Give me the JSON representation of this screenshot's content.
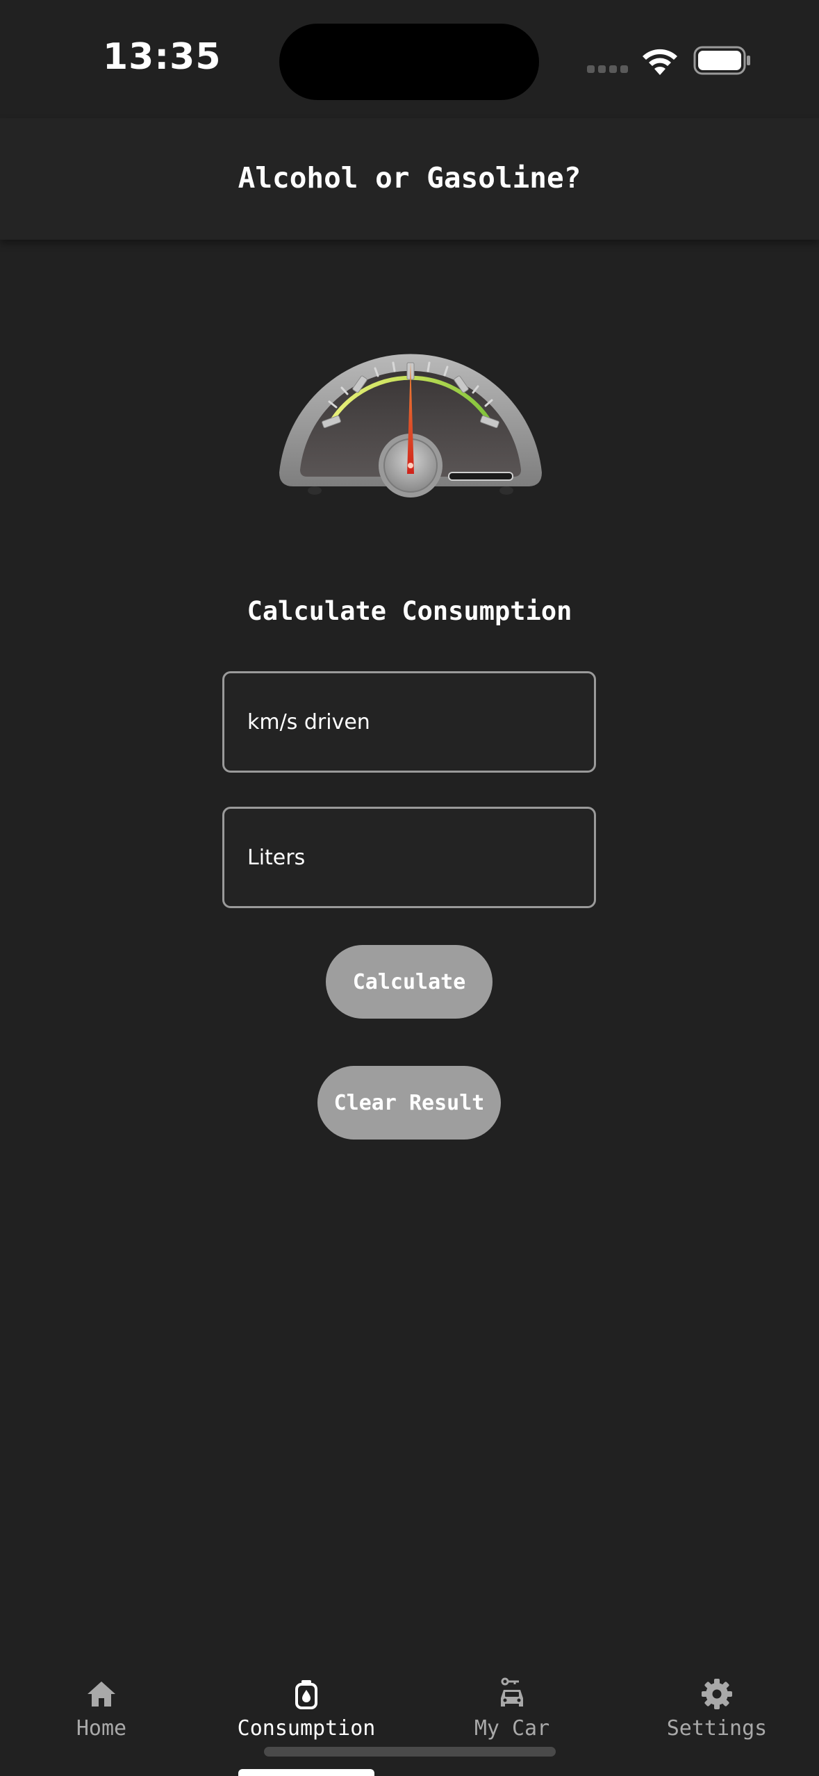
{
  "status_bar": {
    "time": "13:35",
    "icons": [
      "signal-icon",
      "wifi-icon",
      "battery-icon"
    ]
  },
  "header": {
    "title": "Alcohol or Gasoline?"
  },
  "gauge": {
    "icon": "speedometer-icon"
  },
  "form": {
    "title": "Calculate Consumption",
    "km_field": {
      "placeholder": "km/s driven",
      "value": ""
    },
    "liters_field": {
      "placeholder": "Liters",
      "value": ""
    },
    "calculate_label": "Calculate",
    "clear_label": "Clear Result"
  },
  "tab_bar": {
    "items": [
      {
        "label": "Home",
        "icon": "home-icon",
        "active": false
      },
      {
        "label": "Consumption",
        "icon": "fuel-icon",
        "active": true
      },
      {
        "label": "My Car",
        "icon": "car-icon",
        "active": false
      },
      {
        "label": "Settings",
        "icon": "gear-icon",
        "active": false
      }
    ]
  },
  "colors": {
    "background": "#212121",
    "button": "#9e9e9e",
    "field_border": "#9a9a9a",
    "tab_inactive": "#a9a9a9",
    "tab_active": "#ffffff"
  }
}
